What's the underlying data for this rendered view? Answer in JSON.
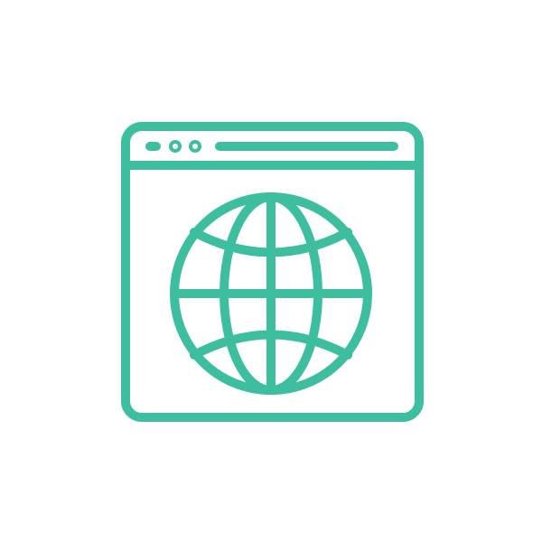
{
  "icon": {
    "name": "browser-globe-icon",
    "color": "#3dbf9f",
    "background": "#ffffff",
    "parts": [
      "browser-window",
      "title-bar-dots",
      "address-bar",
      "globe"
    ]
  }
}
